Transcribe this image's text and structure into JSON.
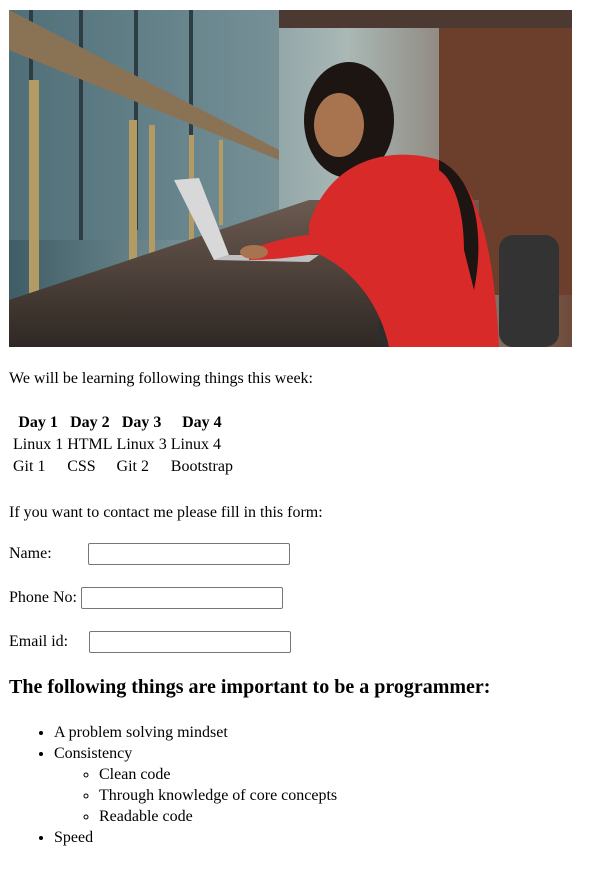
{
  "hero": {
    "image": "woman-laptop-photo"
  },
  "intro": "We will be learning following things this week:",
  "schedule": {
    "headers": [
      "Day 1",
      "Day 2",
      "Day 3",
      "Day 4"
    ],
    "rows": [
      [
        "Linux 1",
        "HTML",
        "Linux 3",
        "Linux 4"
      ],
      [
        "Git 1",
        "CSS",
        "Git 2",
        "Bootstrap"
      ]
    ]
  },
  "contact": {
    "lead": "If you want to contact me please fill in this form:",
    "fields": [
      {
        "label": "Name:",
        "value": "",
        "placeholder": ""
      },
      {
        "label": "Phone No:",
        "value": "",
        "placeholder": ""
      },
      {
        "label": "Email id:",
        "value": "",
        "placeholder": ""
      }
    ]
  },
  "important": {
    "heading": "The following things are important to be a programmer:",
    "items": [
      {
        "text": "A problem solving mindset"
      },
      {
        "text": "Consistency",
        "children": [
          "Clean code",
          "Through knowledge of core concepts",
          "Readable code"
        ]
      },
      {
        "text": "Speed"
      }
    ]
  },
  "colors": {
    "text": "#000000",
    "input_border": "#767676",
    "sweater_red": "#d92a2a"
  }
}
